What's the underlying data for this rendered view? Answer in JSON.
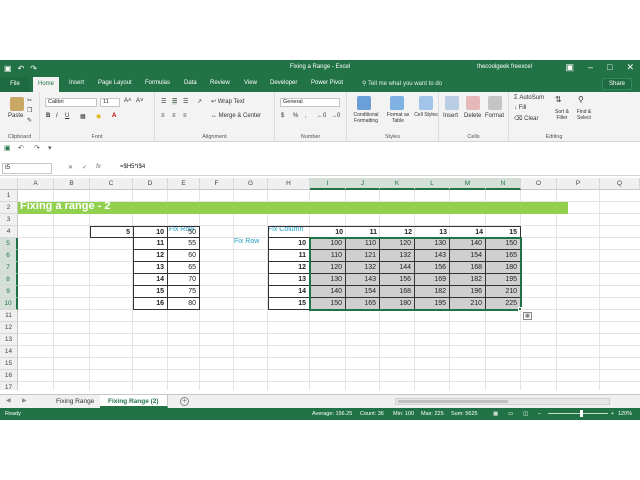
{
  "window": {
    "title": "Fixing a Range - Excel",
    "user": "thecoolgeek freexcel"
  },
  "tabs": {
    "file": "File",
    "home": "Home",
    "insert": "Insert",
    "page_layout": "Page Layout",
    "formulas": "Formulas",
    "data": "Data",
    "review": "Review",
    "view": "View",
    "developer": "Developer",
    "power_pivot": "Power Pivot",
    "tell_me": "Tell me what you want to do",
    "share": "Share"
  },
  "ribbon": {
    "paste": "Paste",
    "font_name": "Calibri",
    "font_size": "11",
    "wrap_text": "Wrap Text",
    "merge_center": "Merge & Center",
    "number_format": "General",
    "conditional": "Conditional Formatting",
    "format_table": "Format as Table",
    "cell_styles": "Cell Styles",
    "insert": "Insert",
    "delete": "Delete",
    "format": "Format",
    "autosum": "AutoSum",
    "fill": "Fill",
    "clear": "Clear",
    "sort_filter": "Sort & Filter",
    "find_select": "Find & Select",
    "groups": {
      "clipboard": "Clipboard",
      "font": "Font",
      "alignment": "Alignment",
      "number": "Number",
      "styles": "Styles",
      "cells": "Cells",
      "editing": "Editing"
    }
  },
  "formula_bar": {
    "name_box": "I5",
    "fx": "fx",
    "formula": "=$H5*I$4"
  },
  "grid": {
    "columns": [
      "A",
      "B",
      "C",
      "D",
      "E",
      "F",
      "G",
      "H",
      "I",
      "J",
      "K",
      "L",
      "M",
      "N",
      "O",
      "P",
      "Q"
    ],
    "rows": [
      "1",
      "2",
      "3",
      "4",
      "5",
      "6",
      "7",
      "8",
      "9",
      "10",
      "11",
      "12",
      "13",
      "14",
      "15",
      "16",
      "17"
    ],
    "title": "Fixing a range - 2",
    "fix_row_label": "Fix Row",
    "fix_column_label": "Fix Column",
    "fix_row_side": "Fix Row",
    "c4": "5",
    "d_values": [
      "10",
      "11",
      "12",
      "13",
      "14",
      "15",
      "16"
    ],
    "e_values": [
      "50",
      "55",
      "60",
      "65",
      "70",
      "75",
      "80"
    ],
    "col_headers_i_to_n": [
      "10",
      "11",
      "12",
      "13",
      "14",
      "15"
    ],
    "h_values": [
      "10",
      "11",
      "12",
      "13",
      "14",
      "15"
    ],
    "table": [
      [
        "100",
        "110",
        "120",
        "130",
        "140",
        "150"
      ],
      [
        "110",
        "121",
        "132",
        "143",
        "154",
        "165"
      ],
      [
        "120",
        "132",
        "144",
        "156",
        "168",
        "180"
      ],
      [
        "130",
        "143",
        "156",
        "169",
        "182",
        "195"
      ],
      [
        "140",
        "154",
        "168",
        "182",
        "196",
        "210"
      ],
      [
        "150",
        "165",
        "180",
        "195",
        "210",
        "225"
      ]
    ]
  },
  "sheets": {
    "tab1": "Fixing Range",
    "tab2": "Fixing Range (2)"
  },
  "status": {
    "ready": "Ready",
    "average": "Average: 156.25",
    "count": "Count: 36",
    "min": "Min: 100",
    "max": "Max: 225",
    "sum": "Sum: 5625",
    "zoom": "120%"
  }
}
